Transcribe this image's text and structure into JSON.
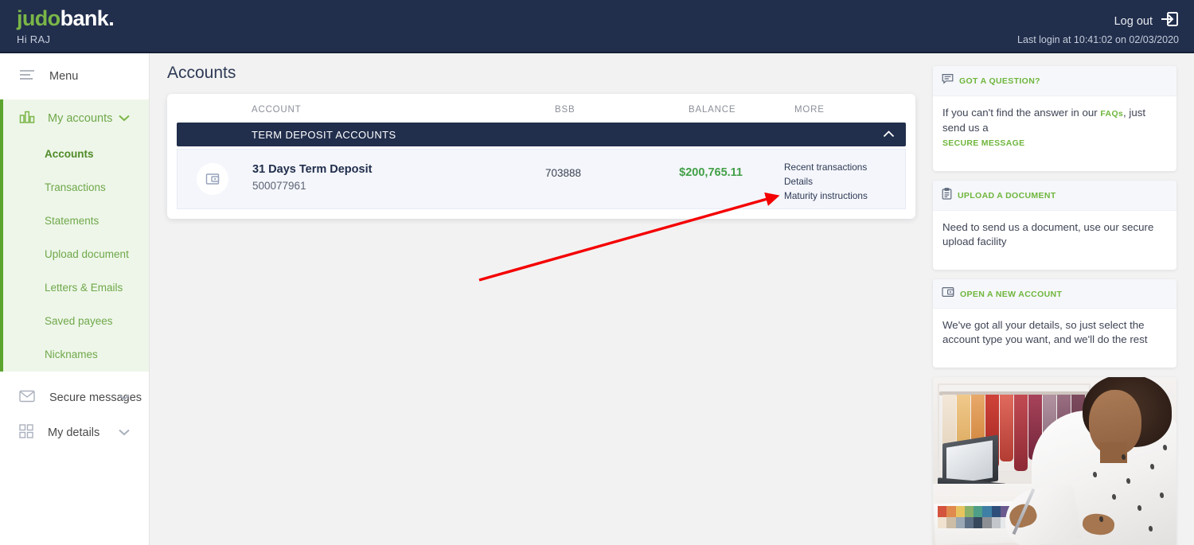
{
  "header": {
    "logo_part1": "judo",
    "logo_part2": "bank",
    "logo_dot": ".",
    "greeting": "Hi RAJ",
    "logout_label": "Log out",
    "last_login": "Last login at 10:41:02 on 02/03/2020"
  },
  "sidebar": {
    "menu_label": "Menu",
    "groups": [
      {
        "label": "My accounts",
        "icon": "bar-chart-icon",
        "expanded": true,
        "items": [
          {
            "label": "Accounts",
            "active": true
          },
          {
            "label": "Transactions",
            "active": false
          },
          {
            "label": "Statements",
            "active": false
          },
          {
            "label": "Upload document",
            "active": false
          },
          {
            "label": "Letters & Emails",
            "active": false
          },
          {
            "label": "Saved payees",
            "active": false
          },
          {
            "label": "Nicknames",
            "active": false
          }
        ]
      }
    ],
    "plain_items": [
      {
        "label": "Secure messages",
        "icon": "envelope-icon"
      },
      {
        "label": "My details",
        "icon": "grid-icon"
      }
    ]
  },
  "main": {
    "page_title": "Accounts",
    "columns": {
      "account": "ACCOUNT",
      "bsb": "BSB",
      "balance": "BALANCE",
      "more": "MORE"
    },
    "group_bar": {
      "label": "TERM DEPOSIT ACCOUNTS",
      "collapse_icon": "chevron-up-icon"
    },
    "accounts": [
      {
        "icon": "wallet-icon",
        "name": "31 Days Term Deposit",
        "number": "500077961",
        "bsb": "703888",
        "balance": "$200,765.11",
        "links": [
          "Recent transactions",
          "Details",
          "Maturity instructions"
        ]
      }
    ]
  },
  "rail": {
    "promos": [
      {
        "icon": "chat-bubble-icon",
        "title": "GOT A QUESTION?",
        "body_pre": "If you can't find the answer in our ",
        "link1": "FAQs",
        "body_mid": ", just send us a",
        "link2": "SECURE MESSAGE"
      },
      {
        "icon": "clipboard-icon",
        "title": "UPLOAD A DOCUMENT",
        "body": "Need to send us a document, use our secure upload facility"
      },
      {
        "icon": "wallet-icon",
        "title": "OPEN A NEW ACCOUNT",
        "body": "We've got all your details, so just select the account type you want, and we'll do the rest"
      }
    ],
    "image_alt": "woman designer working at desk with fabric swatches and laptop"
  },
  "annotation": {
    "arrow_color": "#f40000",
    "points_to": "Maturity instructions"
  },
  "colors": {
    "navy": "#212e4c",
    "green": "#6fb63c",
    "balance_green": "#43a047",
    "page_bg": "#f2f2f2"
  }
}
